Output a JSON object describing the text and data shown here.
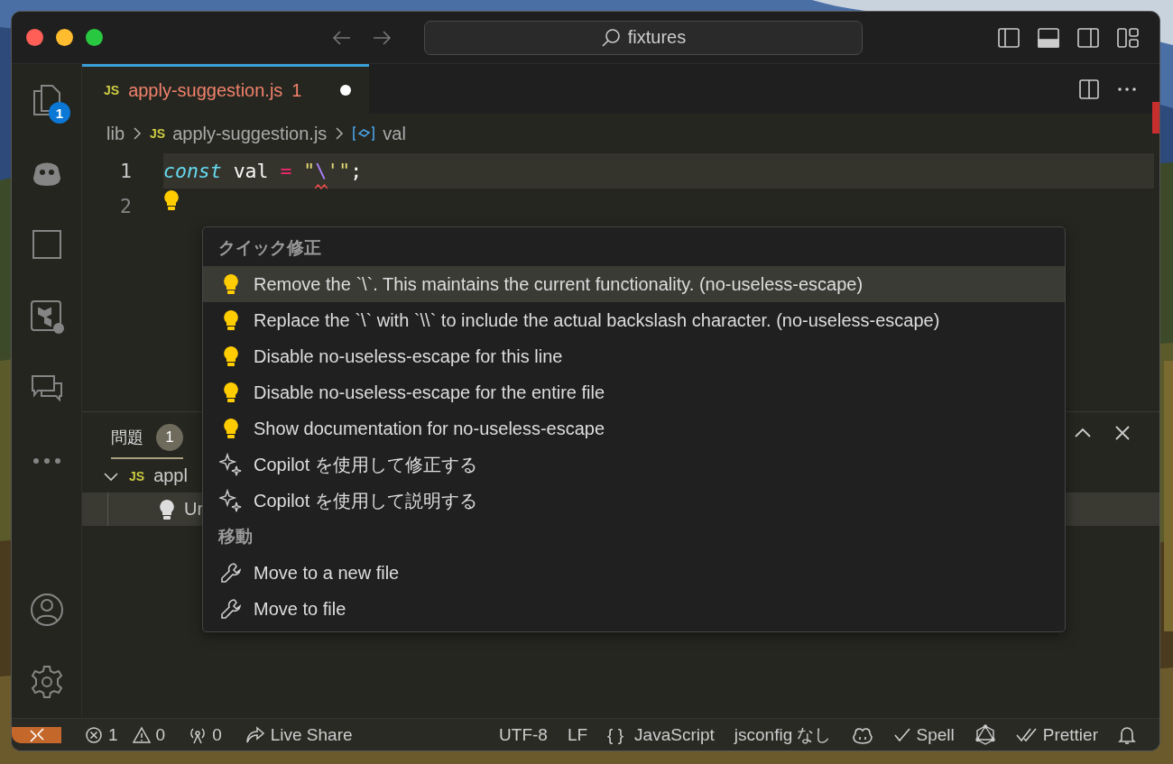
{
  "title_bar": {
    "search": "fixtures"
  },
  "activity_bar": {
    "explorer_badge": "1"
  },
  "tabs": [
    {
      "icon": "JS",
      "label": "apply-suggestion.js",
      "problems": "1",
      "modified": true,
      "selected": true
    }
  ],
  "breadcrumb": [
    {
      "kind": "folder",
      "label": "lib"
    },
    {
      "kind": "file",
      "icon": "JS",
      "label": "apply-suggestion.js"
    },
    {
      "kind": "variable",
      "label": "val"
    }
  ],
  "editor": {
    "lines": [
      {
        "number": "1",
        "current": true,
        "tokens": [
          {
            "kind": "keyword",
            "text": "const"
          },
          {
            "kind": "plain",
            "text": " val "
          },
          {
            "kind": "operator",
            "text": "= "
          },
          {
            "kind": "string",
            "text": "\""
          },
          {
            "kind": "escape",
            "text": "\\",
            "error": true
          },
          {
            "kind": "string",
            "text": "'\""
          },
          {
            "kind": "plain",
            "text": ";"
          }
        ]
      },
      {
        "number": "2",
        "current": false,
        "lightbulb": true
      }
    ]
  },
  "panel": {
    "tabs": [
      {
        "label": "問題",
        "count": "1",
        "selected": true
      }
    ],
    "tree": [
      {
        "icon": "JS",
        "label": "appl",
        "expanded": true,
        "children": [
          {
            "label": "Ur",
            "selected": true
          }
        ]
      }
    ]
  },
  "quick_fix": {
    "items": [
      {
        "kind": "header",
        "label": "クイック修正"
      },
      {
        "kind": "bulb",
        "label": "Remove the `\\`. This maintains the current functionality. (no-useless-escape)",
        "selected": true
      },
      {
        "kind": "bulb",
        "label": "Replace the `\\` with `\\\\` to include the actual backslash character. (no-useless-escape)",
        "selected": false
      },
      {
        "kind": "bulb",
        "label": "Disable no-useless-escape for this line",
        "selected": false
      },
      {
        "kind": "bulb",
        "label": "Disable no-useless-escape for the entire file",
        "selected": false
      },
      {
        "kind": "bulb",
        "label": "Show documentation for no-useless-escape",
        "selected": false
      },
      {
        "kind": "sparkle",
        "label": "Copilot を使用して修正する",
        "selected": false
      },
      {
        "kind": "sparkle",
        "label": "Copilot を使用して説明する",
        "selected": false
      },
      {
        "kind": "header",
        "label": "移動"
      },
      {
        "kind": "wrench",
        "label": "Move to a new file",
        "selected": false
      },
      {
        "kind": "wrench",
        "label": "Move to file",
        "selected": false
      }
    ]
  },
  "status_bar": {
    "left": [
      {
        "kind": "remote"
      },
      {
        "kind": "problems",
        "errors": "1",
        "warnings": "0"
      },
      {
        "kind": "ports",
        "label": "0"
      },
      {
        "kind": "live-share",
        "label": "Live Share"
      }
    ],
    "right": [
      {
        "kind": "text",
        "label": "UTF-8"
      },
      {
        "kind": "text",
        "label": "LF"
      },
      {
        "kind": "language",
        "icon": "{ }",
        "label": "JavaScript"
      },
      {
        "kind": "text",
        "label": "jsconfig なし"
      },
      {
        "kind": "copilot"
      },
      {
        "kind": "check",
        "label": "Spell"
      },
      {
        "kind": "graph"
      },
      {
        "kind": "double-check",
        "label": "Prettier"
      },
      {
        "kind": "bell"
      }
    ]
  }
}
